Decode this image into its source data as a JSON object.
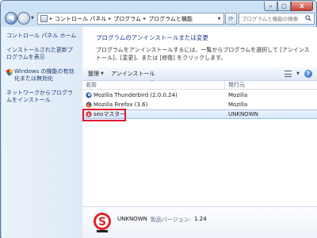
{
  "window": {
    "caption_min": "–",
    "caption_max": "□",
    "caption_close": "X"
  },
  "navigation": {
    "back_glyph": "◀",
    "forward_glyph": "▶",
    "breadcrumb": [
      "コントロール パネル",
      "プログラム",
      "プログラムと機能"
    ],
    "search_placeholder": "プログラムと機能の検索"
  },
  "left_pane": {
    "links": [
      "コントロール パネル ホーム",
      "インストールされた更新プログラムを表示",
      "Windows の機能の有効化または無効化",
      "ネットワークからプログラムをインストール"
    ]
  },
  "main": {
    "heading": "プログラムのアンインストールまたは変更",
    "description": "プログラムをアンインストールするには、一覧からプログラムを選択して [アンインストール]、[変更]、または [修復] をクリックします。",
    "toolbar": {
      "organize": "整理",
      "uninstall": "アンインストール"
    },
    "columns": {
      "name": "名前",
      "publisher": "発行元"
    },
    "programs": [
      {
        "name": "Mozilla Thunderbird (2.0.0.24)",
        "publisher": "Mozilla",
        "icon": "thunderbird-icon"
      },
      {
        "name": "Mozilla Firefox (3.6)",
        "publisher": "Mozilla",
        "icon": "firefox-icon"
      },
      {
        "name": "seoマスター",
        "publisher": "UNKNOWN",
        "icon": "seo-master-icon",
        "selected": true
      }
    ]
  },
  "details": {
    "publisher": "UNKNOWN",
    "version_label": "製品バージョン:",
    "version": "1.24"
  },
  "colors": {
    "highlight_box": "#e3182d",
    "link": "#1f3b70",
    "heading": "#1e3a8a"
  }
}
